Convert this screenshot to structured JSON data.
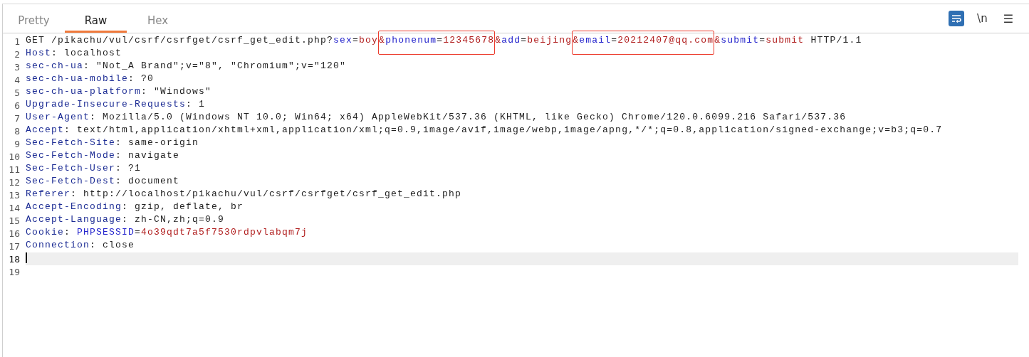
{
  "tabs": [
    {
      "label": "Pretty",
      "selected": false
    },
    {
      "label": "Raw",
      "selected": true
    },
    {
      "label": "Hex",
      "selected": false
    }
  ],
  "toolbar": {
    "newline_toggle": "\\n",
    "menu": "☰"
  },
  "lines": [
    {
      "number": "1",
      "current": false,
      "segments": [
        {
          "boxed": false,
          "tokens": [
            {
              "kind": "plain",
              "text": "GET /pikachu/vul/csrf/csrfget/csrf_get_edit.php?"
            },
            {
              "kind": "param_name",
              "text": "sex"
            },
            {
              "kind": "plain",
              "text": "="
            },
            {
              "kind": "param_value",
              "text": "boy"
            }
          ]
        },
        {
          "boxed": true,
          "tokens": [
            {
              "kind": "param_value",
              "text": "&"
            },
            {
              "kind": "param_name",
              "text": "phonenum"
            },
            {
              "kind": "plain",
              "text": "="
            },
            {
              "kind": "param_value",
              "text": "12345678"
            }
          ]
        },
        {
          "boxed": false,
          "tokens": [
            {
              "kind": "param_value",
              "text": "&"
            },
            {
              "kind": "param_name",
              "text": "add"
            },
            {
              "kind": "plain",
              "text": "="
            },
            {
              "kind": "param_value",
              "text": "beijing"
            }
          ]
        },
        {
          "boxed": true,
          "tokens": [
            {
              "kind": "param_value",
              "text": "&"
            },
            {
              "kind": "param_name",
              "text": "email"
            },
            {
              "kind": "plain",
              "text": "="
            },
            {
              "kind": "param_value",
              "text": "20212407@qq.com"
            }
          ]
        },
        {
          "boxed": false,
          "tokens": [
            {
              "kind": "param_value",
              "text": "&"
            },
            {
              "kind": "param_name",
              "text": "submit"
            },
            {
              "kind": "plain",
              "text": "="
            },
            {
              "kind": "param_value",
              "text": "submit"
            },
            {
              "kind": "plain",
              "text": " HTTP/1.1"
            }
          ]
        }
      ]
    },
    {
      "number": "2",
      "current": false,
      "segments": [
        {
          "boxed": false,
          "tokens": [
            {
              "kind": "header_name",
              "text": "Host"
            },
            {
              "kind": "plain",
              "text": ": localhost"
            }
          ]
        }
      ]
    },
    {
      "number": "3",
      "current": false,
      "segments": [
        {
          "boxed": false,
          "tokens": [
            {
              "kind": "header_name",
              "text": "sec-ch-ua"
            },
            {
              "kind": "plain",
              "text": ": \"Not_A Brand\";v=\"8\", \"Chromium\";v=\"120\""
            }
          ]
        }
      ]
    },
    {
      "number": "4",
      "current": false,
      "segments": [
        {
          "boxed": false,
          "tokens": [
            {
              "kind": "header_name",
              "text": "sec-ch-ua-mobile"
            },
            {
              "kind": "plain",
              "text": ": ?0"
            }
          ]
        }
      ]
    },
    {
      "number": "5",
      "current": false,
      "segments": [
        {
          "boxed": false,
          "tokens": [
            {
              "kind": "header_name",
              "text": "sec-ch-ua-platform"
            },
            {
              "kind": "plain",
              "text": ": \"Windows\""
            }
          ]
        }
      ]
    },
    {
      "number": "6",
      "current": false,
      "segments": [
        {
          "boxed": false,
          "tokens": [
            {
              "kind": "header_name",
              "text": "Upgrade-Insecure-Requests"
            },
            {
              "kind": "plain",
              "text": ": 1"
            }
          ]
        }
      ]
    },
    {
      "number": "7",
      "current": false,
      "segments": [
        {
          "boxed": false,
          "tokens": [
            {
              "kind": "header_name",
              "text": "User-Agent"
            },
            {
              "kind": "plain",
              "text": ": Mozilla/5.0 (Windows NT 10.0; Win64; x64) AppleWebKit/537.36 (KHTML, like Gecko) Chrome/120.0.6099.216 Safari/537.36"
            }
          ]
        }
      ]
    },
    {
      "number": "8",
      "current": false,
      "segments": [
        {
          "boxed": false,
          "tokens": [
            {
              "kind": "header_name",
              "text": "Accept"
            },
            {
              "kind": "plain",
              "text": ": text/html,application/xhtml+xml,application/xml;q=0.9,image/avif,image/webp,image/apng,*/*;q=0.8,application/signed-exchange;v=b3;q=0.7"
            }
          ]
        }
      ]
    },
    {
      "number": "9",
      "current": false,
      "segments": [
        {
          "boxed": false,
          "tokens": [
            {
              "kind": "header_name",
              "text": "Sec-Fetch-Site"
            },
            {
              "kind": "plain",
              "text": ": same-origin"
            }
          ]
        }
      ]
    },
    {
      "number": "10",
      "current": false,
      "segments": [
        {
          "boxed": false,
          "tokens": [
            {
              "kind": "header_name",
              "text": "Sec-Fetch-Mode"
            },
            {
              "kind": "plain",
              "text": ": navigate"
            }
          ]
        }
      ]
    },
    {
      "number": "11",
      "current": false,
      "segments": [
        {
          "boxed": false,
          "tokens": [
            {
              "kind": "header_name",
              "text": "Sec-Fetch-User"
            },
            {
              "kind": "plain",
              "text": ": ?1"
            }
          ]
        }
      ]
    },
    {
      "number": "12",
      "current": false,
      "segments": [
        {
          "boxed": false,
          "tokens": [
            {
              "kind": "header_name",
              "text": "Sec-Fetch-Dest"
            },
            {
              "kind": "plain",
              "text": ": document"
            }
          ]
        }
      ]
    },
    {
      "number": "13",
      "current": false,
      "segments": [
        {
          "boxed": false,
          "tokens": [
            {
              "kind": "header_name",
              "text": "Referer"
            },
            {
              "kind": "plain",
              "text": ": http://localhost/pikachu/vul/csrf/csrfget/csrf_get_edit.php"
            }
          ]
        }
      ]
    },
    {
      "number": "14",
      "current": false,
      "segments": [
        {
          "boxed": false,
          "tokens": [
            {
              "kind": "header_name",
              "text": "Accept-Encoding"
            },
            {
              "kind": "plain",
              "text": ": gzip, deflate, br"
            }
          ]
        }
      ]
    },
    {
      "number": "15",
      "current": false,
      "segments": [
        {
          "boxed": false,
          "tokens": [
            {
              "kind": "header_name",
              "text": "Accept-Language"
            },
            {
              "kind": "plain",
              "text": ": zh-CN,zh;q=0.9"
            }
          ]
        }
      ]
    },
    {
      "number": "16",
      "current": false,
      "segments": [
        {
          "boxed": false,
          "tokens": [
            {
              "kind": "header_name",
              "text": "Cookie"
            },
            {
              "kind": "plain",
              "text": ": "
            },
            {
              "kind": "param_name",
              "text": "PHPSESSID"
            },
            {
              "kind": "plain",
              "text": "="
            },
            {
              "kind": "param_value",
              "text": "4o39qdt7a5f7530rdpvlabqm7j"
            }
          ]
        }
      ]
    },
    {
      "number": "17",
      "current": false,
      "segments": [
        {
          "boxed": false,
          "tokens": [
            {
              "kind": "header_name",
              "text": "Connection"
            },
            {
              "kind": "plain",
              "text": ": close"
            }
          ]
        }
      ]
    },
    {
      "number": "18",
      "current": true
    },
    {
      "number": "19",
      "current": false
    }
  ]
}
